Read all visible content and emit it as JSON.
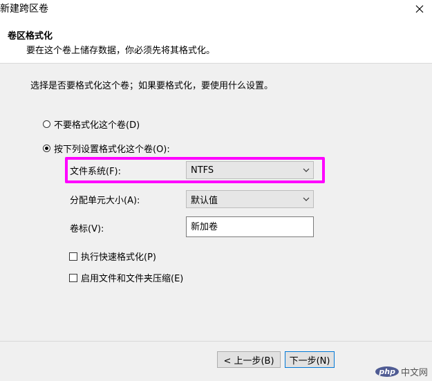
{
  "window": {
    "title": "新建跨区卷",
    "close_glyph": "✕"
  },
  "header": {
    "title": "卷区格式化",
    "subtitle": "要在这个卷上储存数据，你必须先将其格式化。"
  },
  "body": {
    "prompt": "选择是否要格式化这个卷；如果要格式化，要使用什么设置。",
    "options": [
      {
        "label": "不要格式化这个卷(D)",
        "selected": false
      },
      {
        "label": "按下列设置格式化这个卷(O):",
        "selected": true
      }
    ],
    "file_system": {
      "label": "文件系统(F):",
      "value": "NTFS"
    },
    "allocation_unit": {
      "label": "分配单元大小(A):",
      "value": "默认值"
    },
    "volume_label": {
      "label": "卷标(V):",
      "value": "新加卷"
    },
    "checkboxes": [
      {
        "label": "执行快速格式化(P)",
        "checked": false
      },
      {
        "label": "启用文件和文件夹压缩(E)",
        "checked": false
      }
    ]
  },
  "footer": {
    "back_label": "< 上一步(B)",
    "next_label": "下一步(N)"
  },
  "watermark": {
    "logo": "php",
    "site": "中文网"
  },
  "colors": {
    "highlight": "#ff00ff",
    "body_bg": "#f0f0f0",
    "primary_border": "#0078d7"
  }
}
